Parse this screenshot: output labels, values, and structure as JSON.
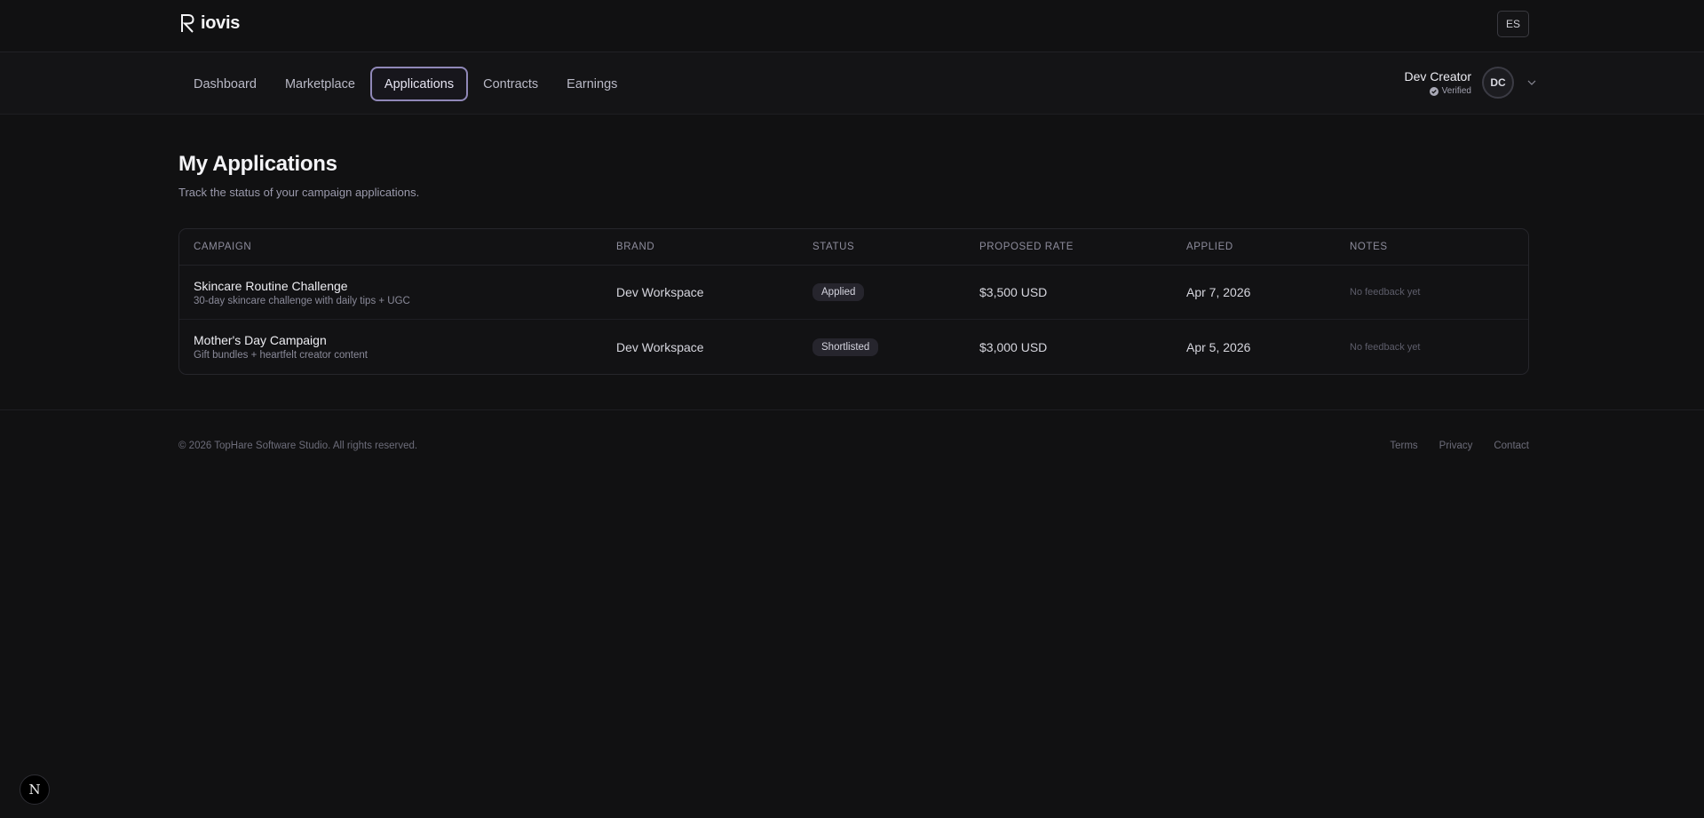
{
  "brand": {
    "name": "iovis",
    "logo_letter": "R"
  },
  "language_button": "ES",
  "nav": {
    "items": [
      {
        "label": "Dashboard",
        "active": false
      },
      {
        "label": "Marketplace",
        "active": false
      },
      {
        "label": "Applications",
        "active": true
      },
      {
        "label": "Contracts",
        "active": false
      },
      {
        "label": "Earnings",
        "active": false
      }
    ]
  },
  "user": {
    "name": "Dev Creator",
    "status": "Verified",
    "initials": "DC"
  },
  "page": {
    "title": "My Applications",
    "subtitle": "Track the status of your campaign applications."
  },
  "table": {
    "headers": [
      "Campaign",
      "Brand",
      "Status",
      "Proposed Rate",
      "Applied",
      "Notes"
    ],
    "rows": [
      {
        "campaign": "Skincare Routine Challenge",
        "description": "30-day skincare challenge with daily tips + UGC",
        "brand": "Dev Workspace",
        "status": "Applied",
        "rate": "$3,500 USD",
        "applied": "Apr 7, 2026",
        "notes": "No feedback yet"
      },
      {
        "campaign": "Mother's Day Campaign",
        "description": "Gift bundles + heartfelt creator content",
        "brand": "Dev Workspace",
        "status": "Shortlisted",
        "rate": "$3,000 USD",
        "applied": "Apr 5, 2026",
        "notes": "No feedback yet"
      }
    ]
  },
  "footer": {
    "copyright": "© 2026 TopHare Software Studio. All rights reserved.",
    "links": [
      "Terms",
      "Privacy",
      "Contact"
    ]
  },
  "dev_badge": "N",
  "colors": {
    "accent": "#9088b8",
    "background": "#111112"
  }
}
